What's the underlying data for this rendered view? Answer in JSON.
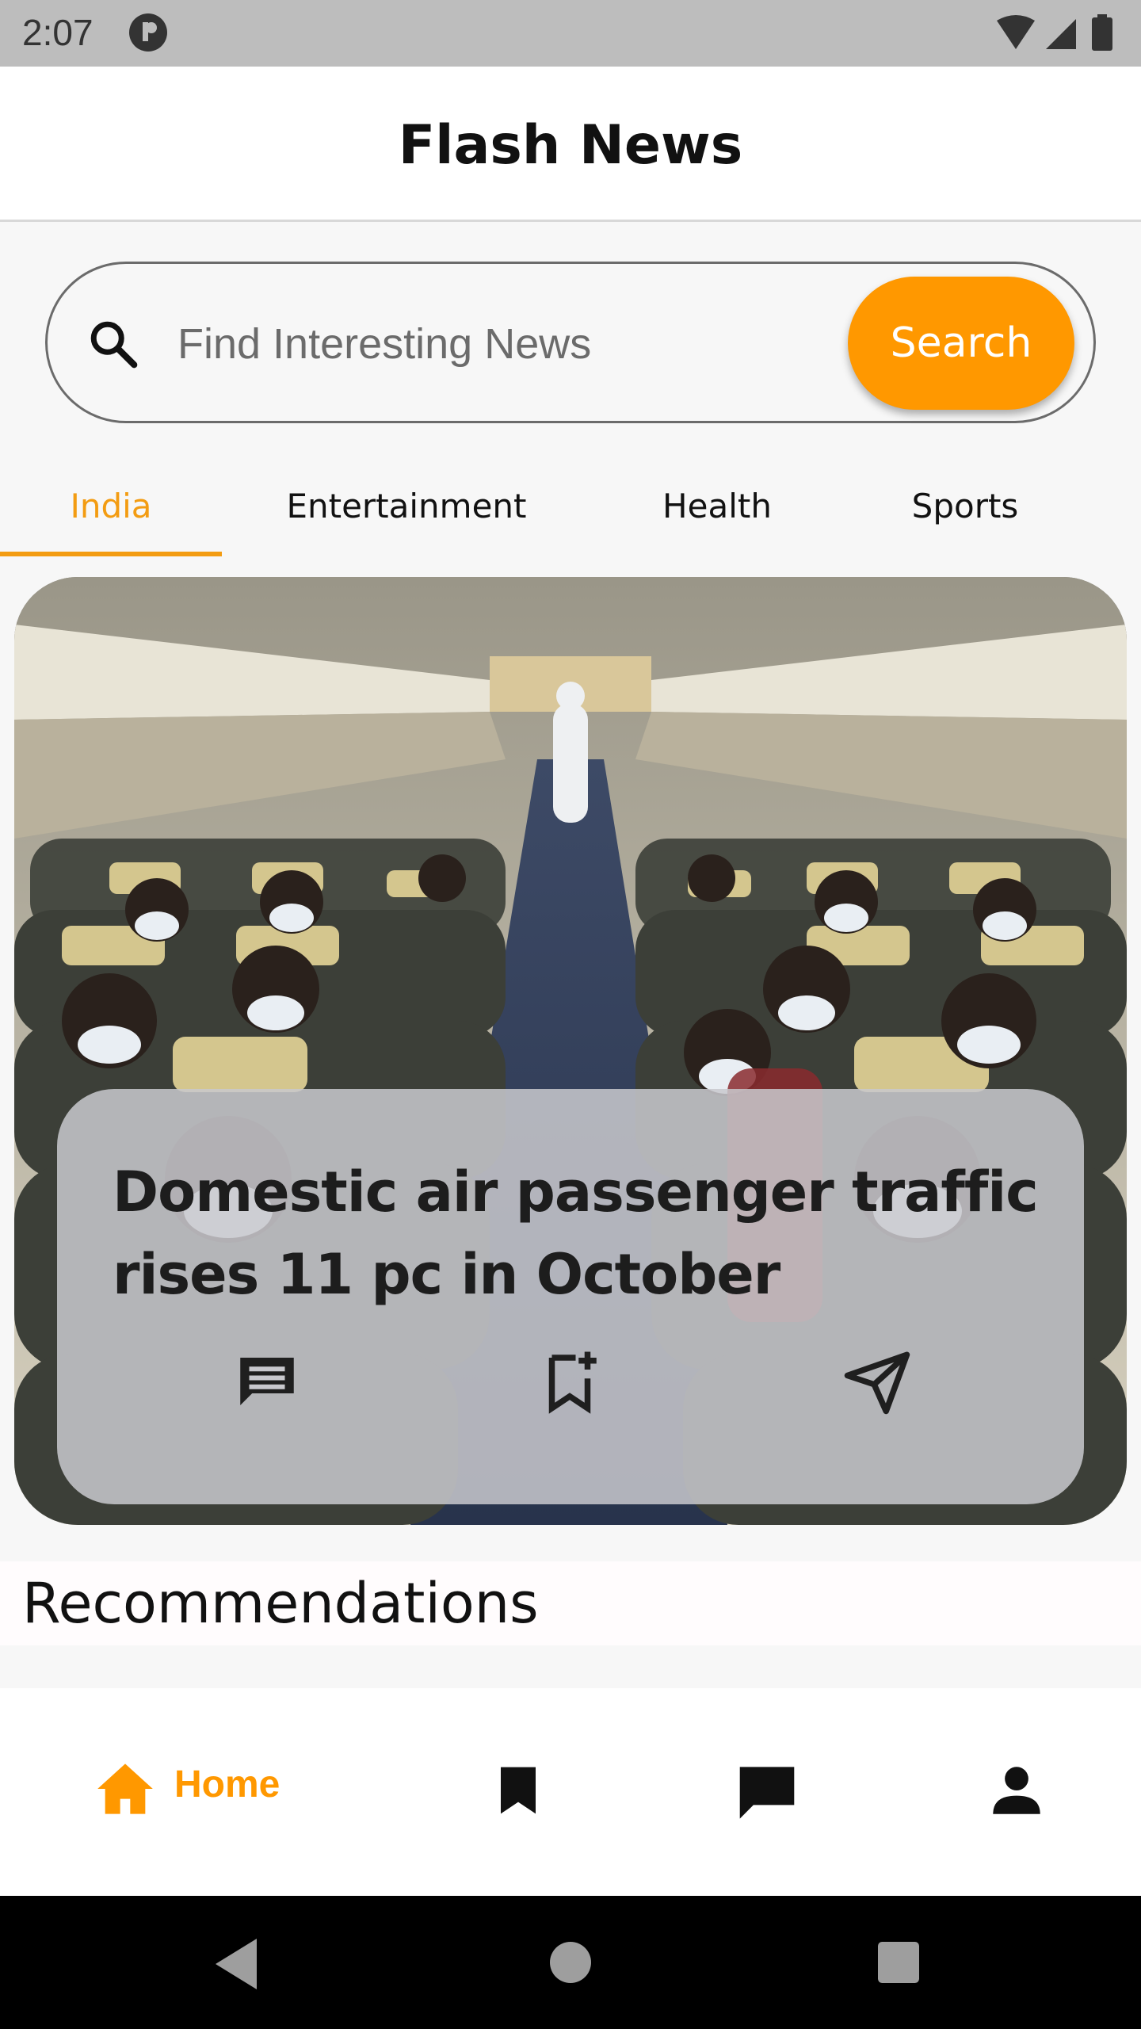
{
  "status_bar": {
    "time": "2:07"
  },
  "header": {
    "title": "Flash News"
  },
  "search": {
    "placeholder": "Find Interesting News",
    "button_label": "Search"
  },
  "tabs": [
    {
      "label": "India",
      "active": true
    },
    {
      "label": "Entertainment",
      "active": false
    },
    {
      "label": "Health",
      "active": false
    },
    {
      "label": "Sports",
      "active": false
    }
  ],
  "featured": {
    "headline": "Domestic air passenger traffic rises 11 pc in October",
    "actions": [
      "comment-icon",
      "bookmark-add-icon",
      "share-send-icon"
    ]
  },
  "section": {
    "recommendations_title": "Recommendations"
  },
  "bottom_nav": {
    "items": [
      {
        "icon": "home-icon",
        "label": "Home",
        "active": true
      },
      {
        "icon": "bookmark-icon",
        "label": "",
        "active": false
      },
      {
        "icon": "chat-icon",
        "label": "",
        "active": false
      },
      {
        "icon": "person-icon",
        "label": "",
        "active": false
      }
    ]
  },
  "colors": {
    "accent": "#ff9800",
    "tab_active": "#f39c12",
    "status_bar": "#bdbdbd"
  }
}
